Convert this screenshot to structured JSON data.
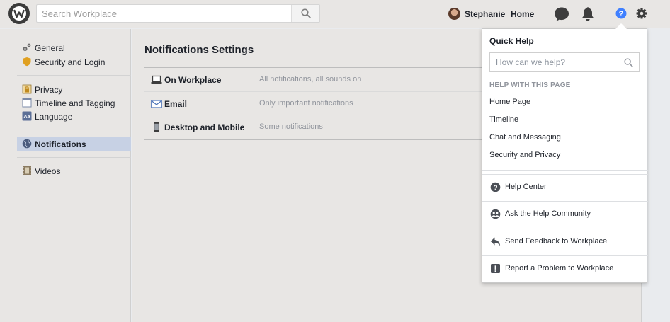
{
  "topbar": {
    "search_placeholder": "Search Workplace",
    "user_name": "Stephanie",
    "home_label": "Home",
    "icons": [
      "workplace-logo-icon",
      "search-icon",
      "chat-icon",
      "bell-icon",
      "help-icon",
      "gear-icon"
    ]
  },
  "sidebar": {
    "groups": [
      [
        {
          "label": "General",
          "icon": "gears-icon"
        },
        {
          "label": "Security and Login",
          "icon": "shield-icon"
        }
      ],
      [
        {
          "label": "Privacy",
          "icon": "lock-icon"
        },
        {
          "label": "Timeline and Tagging",
          "icon": "timeline-icon"
        },
        {
          "label": "Language",
          "icon": "language-icon"
        }
      ],
      [
        {
          "label": "Notifications",
          "icon": "globe-icon",
          "active": true
        }
      ],
      [
        {
          "label": "Videos",
          "icon": "film-icon"
        }
      ]
    ]
  },
  "main": {
    "title": "Notifications Settings",
    "rows": [
      {
        "name": "On Workplace",
        "desc": "All notifications, all sounds on",
        "icon": "laptop-icon"
      },
      {
        "name": "Email",
        "desc": "Only important notifications",
        "icon": "envelope-icon"
      },
      {
        "name": "Desktop and Mobile",
        "desc": "Some notifications",
        "icon": "phone-icon"
      }
    ]
  },
  "quick_help": {
    "title": "Quick Help",
    "search_placeholder": "How can we help?",
    "section_label": "HELP WITH THIS PAGE",
    "links": [
      "Home Page",
      "Timeline",
      "Chat and Messaging",
      "Security and Privacy"
    ],
    "actions": [
      {
        "label": "Help Center",
        "icon": "question-circle-icon"
      },
      {
        "label": "Ask the Help Community",
        "icon": "community-icon"
      },
      {
        "label": "Send Feedback to Workplace",
        "icon": "reply-arrow-icon"
      },
      {
        "label": "Report a Problem to Workplace",
        "icon": "exclamation-icon"
      }
    ]
  },
  "colors": {
    "accent": "#4080ff",
    "active_item_bg": "#c7d1e4",
    "muted_text": "#90949c"
  }
}
